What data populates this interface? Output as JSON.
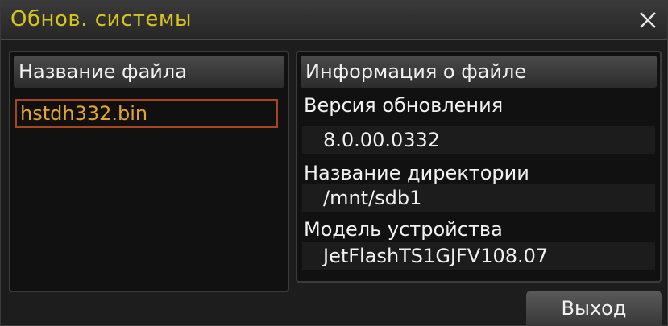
{
  "dialog": {
    "title": "Обнов. системы",
    "close_icon": "close-icon"
  },
  "file_list": {
    "header": "Название файла",
    "items": [
      "hstdh332.bin"
    ],
    "selected_index": 0
  },
  "file_info": {
    "header": "Информация о файле",
    "version_label": "Версия обновления",
    "version_value": "8.0.00.0332",
    "directory_label": "Название директории",
    "directory_value": "/mnt/sdb1",
    "model_label": "Модель устройства",
    "model_value": "JetFlashTS1GJFV108.07"
  },
  "buttons": {
    "exit_label": "Выход"
  },
  "colors": {
    "title_text": "#d8c41e",
    "selected_file_text": "#e6a52a",
    "selected_file_border": "#a8441e",
    "text": "#f2f2f2"
  }
}
